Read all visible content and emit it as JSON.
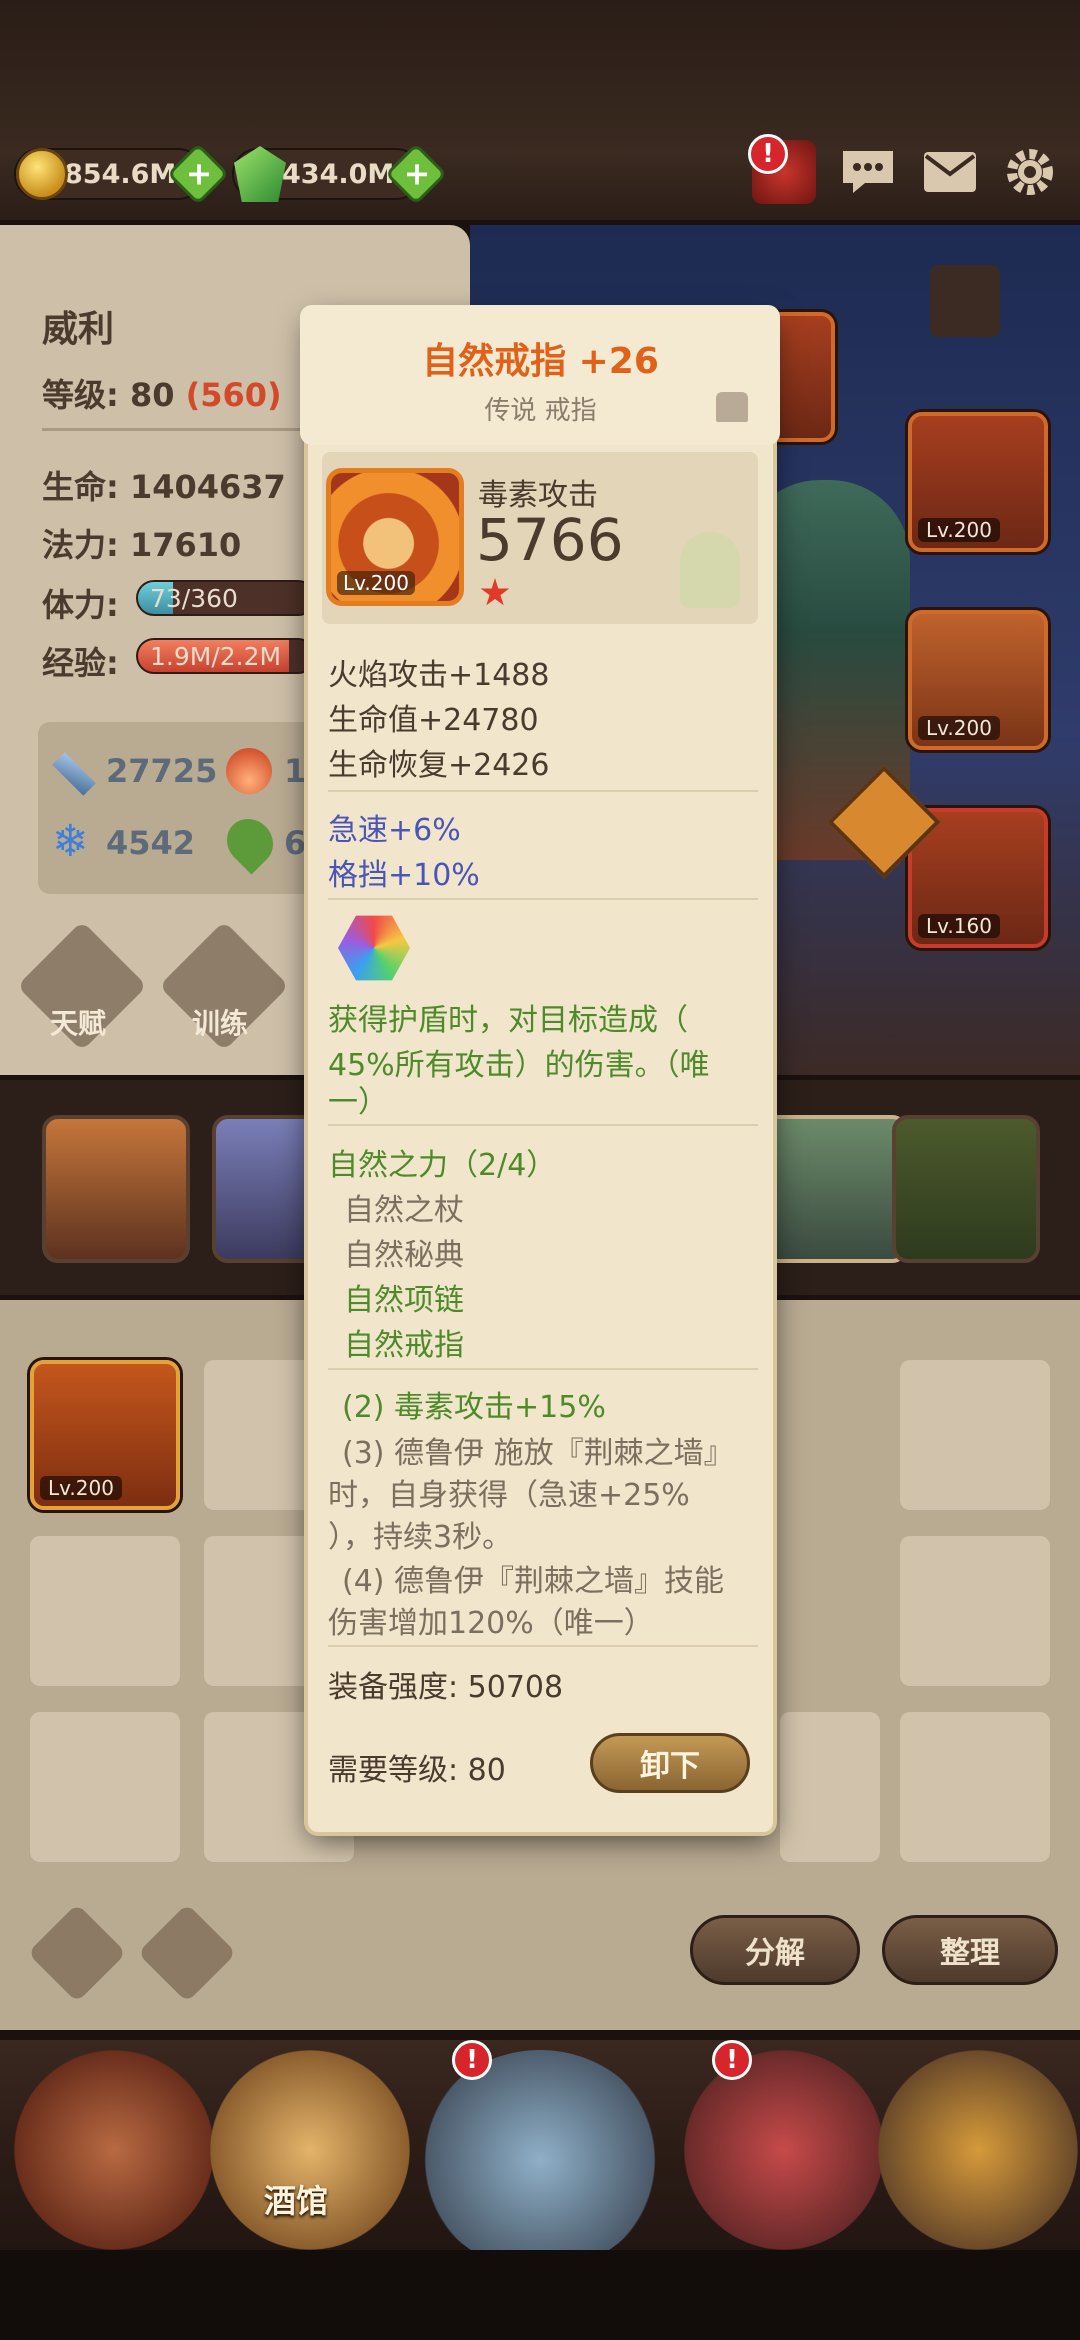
{
  "currency": {
    "gold": "854.6M",
    "gems": "434.0M"
  },
  "hero": {
    "name": "威利",
    "level_label": "等级:",
    "level": "80",
    "level_extra": "(560)",
    "hp_label": "生命:",
    "hp": "1404637",
    "mp_label": "法力:",
    "mp": "17610",
    "stamina_label": "体力:",
    "stamina": "73/360",
    "stamina_fraction": 0.2,
    "exp_label": "经验:",
    "exp": "1.9M/2.2M",
    "exp_fraction": 0.86,
    "attack": "27725",
    "fire_partial": "1",
    "frost": "4542",
    "nature_partial": "6",
    "talent_button": "天赋",
    "train_button": "训练"
  },
  "slots": {
    "slot1_lv": "Lv.200",
    "slot2_lv": "Lv.200",
    "slot3_lv": "Lv.160",
    "inv1_lv": "Lv.200"
  },
  "inventory": {
    "decompose_button": "分解",
    "sort_button": "整理"
  },
  "nav": {
    "tavern": "酒馆"
  },
  "tooltip": {
    "title": "自然戒指 +26",
    "subtitle": "传说 戒指",
    "item_level": "Lv.200",
    "main_stat_label": "毒素攻击",
    "main_stat_value": "5766",
    "stats": [
      "火焰攻击+1488",
      "生命值+24780",
      "生命恢复+2426"
    ],
    "secondary_stats": [
      "急速+6%",
      "格挡+10%"
    ],
    "special_lines": [
      "获得护盾时，对目标造成（",
      "45%所有攻击）的伤害。（唯",
      "一）"
    ],
    "set_title": "自然之力（2/4）",
    "set_items": [
      "自然之杖",
      "自然秘典",
      "自然项链",
      "自然戒指"
    ],
    "set_bonus_2": "(2) 毒素攻击+15%",
    "set_bonus_3": [
      "(3) 德鲁伊 施放『荆棘之墙』",
      "时，自身获得（急速+25%",
      "），持续3秒。"
    ],
    "set_bonus_4": [
      "(4) 德鲁伊『荆棘之墙』技能",
      "伤害增加120%（唯一）"
    ],
    "power_label": "装备强度:",
    "power_value": "50708",
    "req_label": "需要等级:",
    "req_value": "80",
    "unequip_button": "卸下"
  }
}
